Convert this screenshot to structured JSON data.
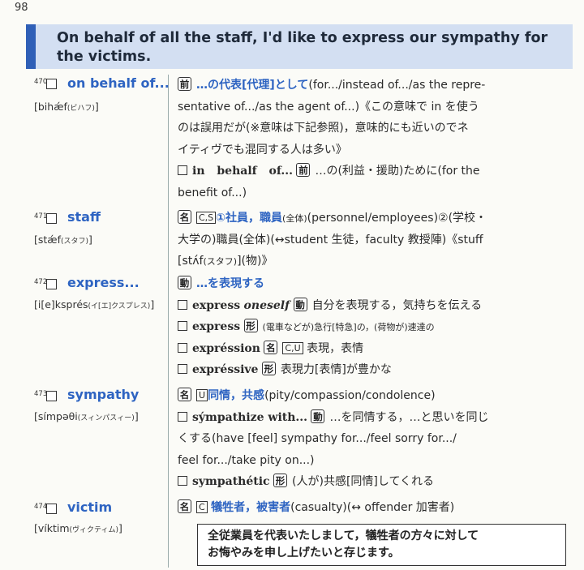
{
  "page_number": "98",
  "header": {
    "sentence": "On behalf of all the staff, I'd like to express our sympathy for the victims."
  },
  "entries": [
    {
      "num": "470",
      "word": "on behalf of...",
      "pron": "[bihǽf",
      "pron_kana": "(ビハフ)",
      "pron_end": "]",
      "pos": "前",
      "lines": [
        "…の代表[代理]として",
        "(for.../instead of.../as the repre-",
        "sentative of.../as the agent of...)《この意味で in を使う",
        "のは誤用だが(※意味は下記参照)，意味的にも近いのでネ",
        "イティヴでも混同する人は多い》",
        "in behalf of...",
        "…の(利益・援助)ために(for the",
        "benefit of...)"
      ]
    },
    {
      "num": "471",
      "word": "staff",
      "pron": "[stǽf",
      "pron_kana": "(スタフ)",
      "pron_end": "]",
      "pos": "名",
      "lines": [
        "C,S",
        "①社員，職員",
        "(全体)",
        "(personnel/employees)②(学校・",
        "大学の)職員(全体)(↔student 生徒，faculty 教授陣)《stuff",
        "[stʌ́f",
        "(スタフ)",
        "](物)》"
      ]
    },
    {
      "num": "472",
      "word": "express...",
      "pron": "[i[e]ksprés",
      "pron_kana": "(イ[エ]クスプレス)",
      "pron_end": "]",
      "pos": "動",
      "lines": [
        "…を表現する",
        "express",
        "oneself",
        "自分を表現する，気持ちを伝える",
        "express",
        "(電車などが)急行[特急]の，(荷物が)速達の",
        "expréssion",
        "C,U",
        "表現，表情",
        "expréssive",
        "表現力[表情]が豊かな"
      ]
    },
    {
      "num": "473",
      "word": "sympathy",
      "pron": "[símpəθi",
      "pron_kana": "(スィンパスィー)",
      "pron_end": "]",
      "pos": "名",
      "lines": [
        "U",
        "同情，共感",
        "(pity/compassion/condolence)",
        "sýmpathize with...",
        "…を同情する，…と思いを同じ",
        "くする(have [feel] sympathy for.../feel sorry for.../",
        "feel for.../take pity on...)",
        "sympathétic",
        "(人が)共感[同情]してくれる"
      ]
    },
    {
      "num": "474",
      "word": "victim",
      "pron": "[víktim",
      "pron_kana": "(ヴィクティム)",
      "pron_end": "]",
      "pos": "名",
      "lines": [
        "C",
        "犠牲者，被害者",
        "(casualty)(↔ offender 加害者)"
      ]
    }
  ],
  "pos_labels": {
    "prep": "前",
    "noun": "名",
    "verb": "動",
    "adj": "形"
  },
  "answer": {
    "line1": "全従業員を代表いたしまして，犠牲者の方々に対して",
    "line2": "お悔やみを申し上げたいと存じます。"
  },
  "colors": {
    "accent": "#2e64c2",
    "header_bg": "#d3dff2",
    "header_bar": "#2f5fb7"
  }
}
